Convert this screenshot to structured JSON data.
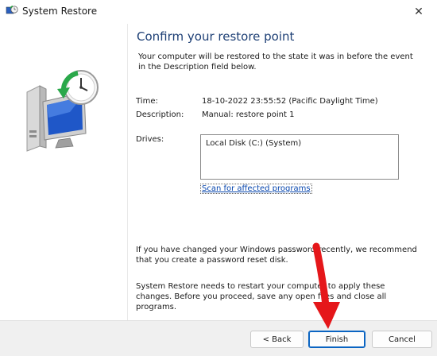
{
  "window": {
    "title": "System Restore",
    "close_glyph": "✕"
  },
  "main": {
    "heading": "Confirm your restore point",
    "intro": "Your computer will be restored to the state it was in before the event in the Description field below.",
    "time_label": "Time:",
    "time_value": "18-10-2022 23:55:52 (Pacific Daylight Time)",
    "description_label": "Description:",
    "description_value": "Manual: restore point 1",
    "drives_label": "Drives:",
    "drives": [
      "Local Disk (C:) (System)"
    ],
    "scan_link": "Scan for affected programs",
    "password_note": "If you have changed your Windows password recently, we recommend that you create a password reset disk.",
    "restart_note": "System Restore needs to restart your computer to apply these changes. Before you proceed, save any open files and close all programs."
  },
  "buttons": {
    "back": "< Back",
    "finish": "Finish",
    "cancel": "Cancel"
  },
  "colors": {
    "heading": "#1d3f75",
    "link": "#0645ad",
    "annotation_arrow": "#e5171a",
    "primary_button_border": "#0a64c2"
  },
  "icons": {
    "app": "system-restore-icon",
    "hero": "system-restore-clock-monitor-icon",
    "close": "close-icon",
    "annotation": "red-arrow-annotation"
  }
}
